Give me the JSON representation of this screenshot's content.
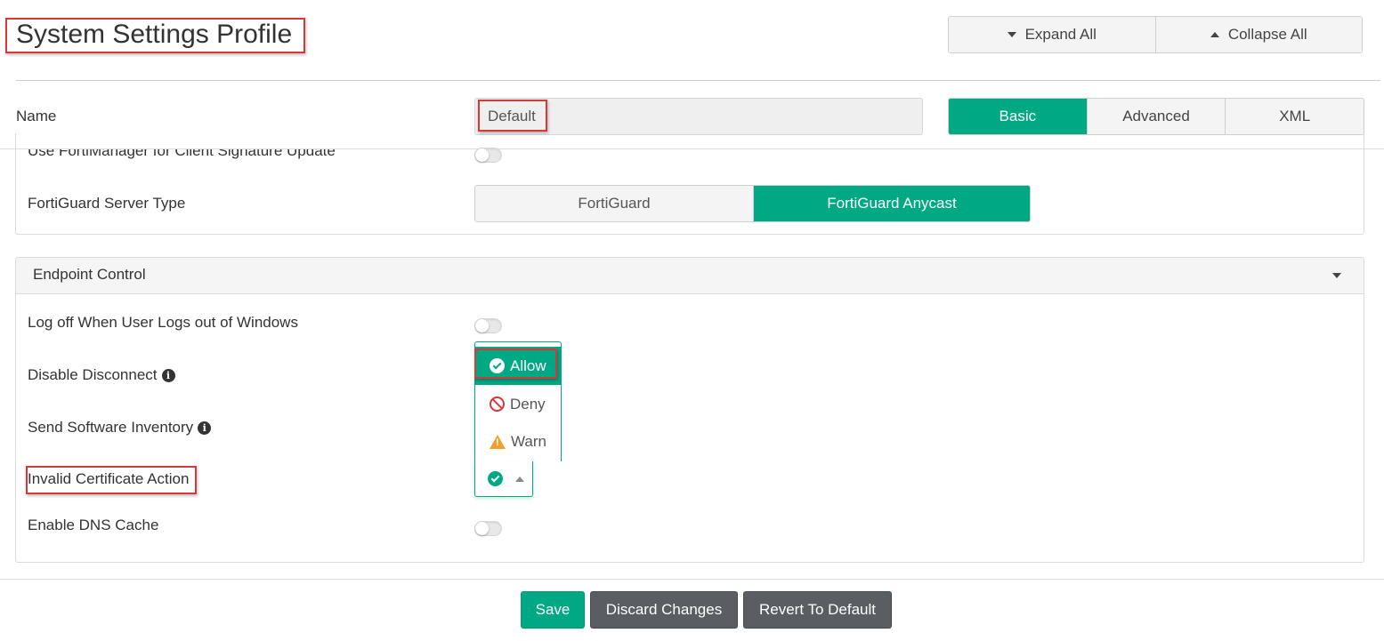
{
  "header": {
    "title": "System Settings Profile",
    "expand_all": "Expand All",
    "collapse_all": "Collapse All"
  },
  "profile": {
    "name_label": "Name",
    "name_value": "Default"
  },
  "view_modes": {
    "basic": "Basic",
    "advanced": "Advanced",
    "xml": "XML",
    "active": "Basic"
  },
  "update_section": {
    "use_fortimanager_label": "Use FortiManager for Client Signature Update",
    "use_fortimanager_enabled": false,
    "server_type_label": "FortiGuard Server Type",
    "server_type_options": [
      "FortiGuard",
      "FortiGuard Anycast"
    ],
    "server_type_selected": "FortiGuard Anycast"
  },
  "endpoint_control": {
    "title": "Endpoint Control",
    "logoff_label": "Log off When User Logs out of Windows",
    "logoff_enabled": false,
    "disable_disconnect_label": "Disable Disconnect",
    "send_inventory_label": "Send Software Inventory",
    "invalid_cert_label": "Invalid Certificate Action",
    "invalid_cert_options": {
      "allow": "Allow",
      "deny": "Deny",
      "warn": "Warn"
    },
    "invalid_cert_selected": "Allow",
    "dns_cache_label": "Enable DNS Cache",
    "dns_cache_enabled": false
  },
  "footer": {
    "save": "Save",
    "discard": "Discard Changes",
    "revert": "Revert To Default"
  },
  "colors": {
    "accent": "#00a884",
    "highlight_box": "#d43a3a",
    "dark_button": "#5a5e63"
  }
}
